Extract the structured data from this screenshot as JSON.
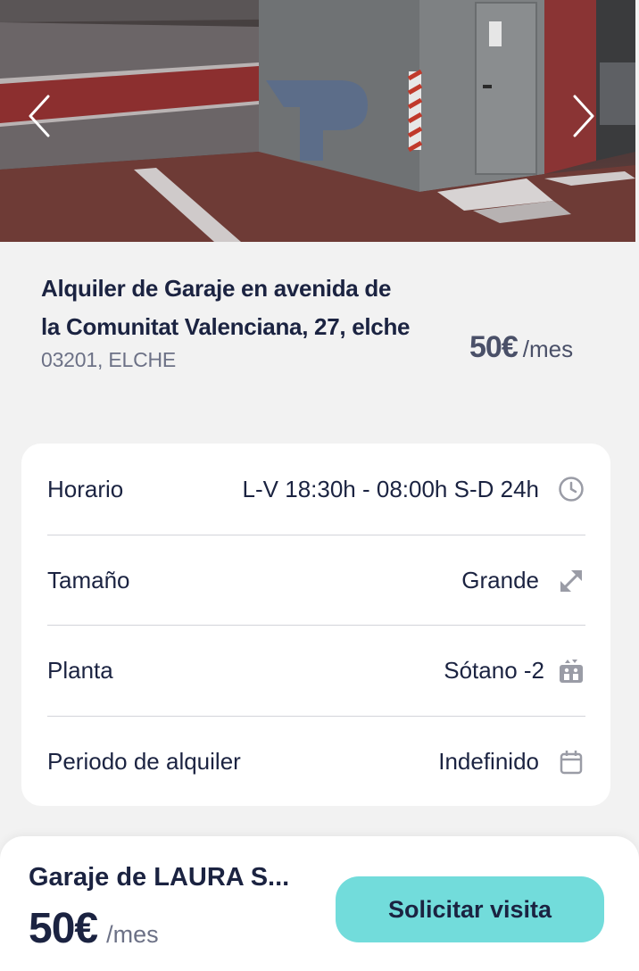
{
  "gallery": {
    "prev_icon": "chevron-left-icon",
    "next_icon": "chevron-right-icon"
  },
  "listing": {
    "title": "Alquiler de Garaje en avenida de la Comunitat Valenciana, 27, elche",
    "postal": "03201, ELCHE",
    "price": "50€",
    "price_unit": "/mes"
  },
  "details": [
    {
      "label": "Horario",
      "value": "L-V 18:30h - 08:00h S-D 24h",
      "icon": "clock-icon"
    },
    {
      "label": "Tamaño",
      "value": "Grande",
      "icon": "expand-arrows-icon"
    },
    {
      "label": "Planta",
      "value": "Sótano -2",
      "icon": "elevator-icon"
    },
    {
      "label": "Periodo de alquiler",
      "value": "Indefinido",
      "icon": "calendar-icon"
    }
  ],
  "bottom": {
    "garage_name": "Garaje de LAURA S...",
    "price": "50€",
    "price_unit": "/mes",
    "cta_label": "Solicitar visita"
  },
  "colors": {
    "primary_text": "#1b2341",
    "muted_text": "#6c7186",
    "cta_background": "#72dcdb",
    "page_background": "#f2f2f2"
  }
}
